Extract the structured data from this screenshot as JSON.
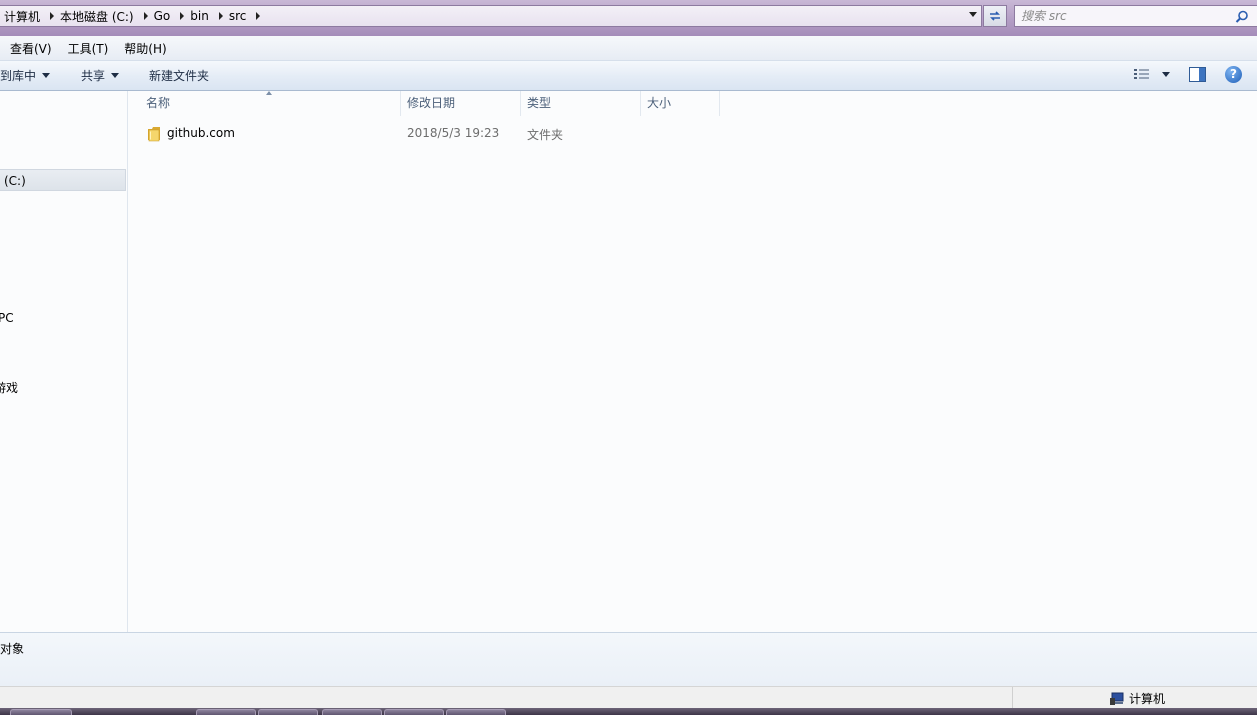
{
  "address_bar": {
    "crumbs": [
      "计算机",
      "本地磁盘 (C:)",
      "Go",
      "bin",
      "src"
    ]
  },
  "search": {
    "placeholder": "搜索 src"
  },
  "menu": {
    "items": [
      "查看(V)",
      "工具(T)",
      "帮助(H)"
    ]
  },
  "toolbar": {
    "include_library": "到库中",
    "share": "共享",
    "new_folder": "新建文件夹"
  },
  "nav_pane": {
    "drive": "(C:)",
    "partial_pc": "PC",
    "partial_games": "游戏"
  },
  "columns": {
    "name": "名称",
    "modified": "修改日期",
    "type": "类型",
    "size": "大小"
  },
  "files": [
    {
      "name": "github.com",
      "modified": "2018/5/3 19:23",
      "type": "文件夹",
      "size": ""
    }
  ],
  "details": {
    "count_text": "对象"
  },
  "status_bar": {
    "location": "计算机"
  },
  "colors": {
    "folder": "#e8c14a",
    "accent": "#1f5fb8"
  },
  "icons": [
    "folder-icon",
    "search-icon",
    "refresh-icon",
    "views-icon",
    "preview-pane-icon",
    "help-icon",
    "computer-icon"
  ]
}
